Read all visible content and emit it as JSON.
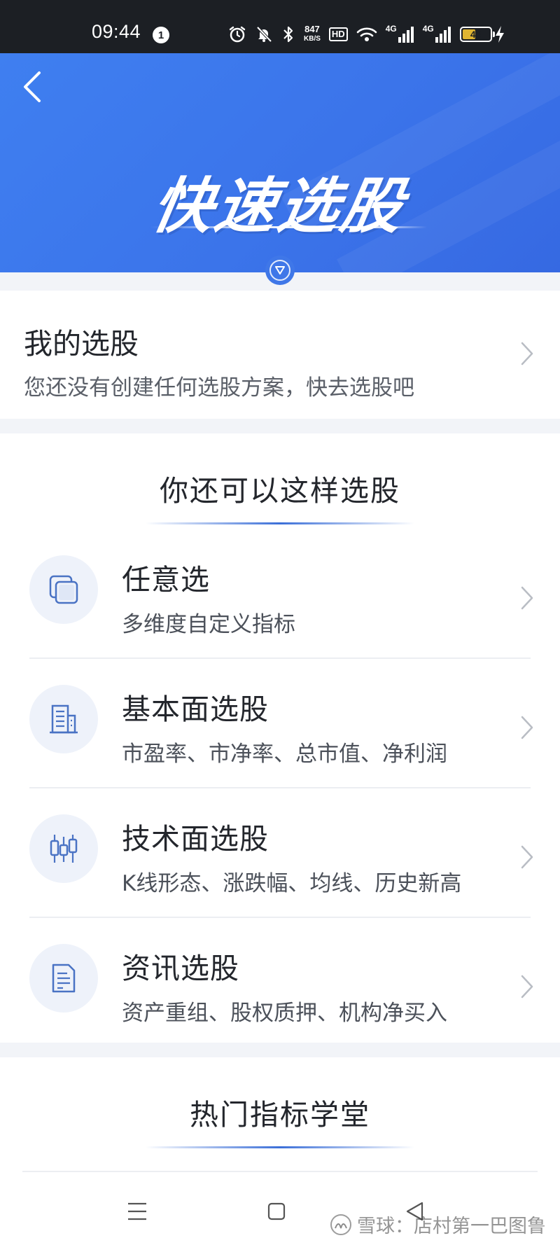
{
  "status_bar": {
    "time": "09:44",
    "notification_count": "1",
    "net_speed_value": "847",
    "net_speed_unit": "KB/S",
    "hd_badge": "HD",
    "signal_1_label": "4G",
    "signal_2_label": "4G",
    "battery_level": "48",
    "battery_fill_fraction": 0.48,
    "battery_color": "#e0b531"
  },
  "banner": {
    "title": "快速选股",
    "back_icon": "chevron-left-icon",
    "expand_icon": "triangle-down-icon",
    "accent_color": "#3b74ea"
  },
  "my_stocks": {
    "title": "我的选股",
    "subtitle": "您还没有创建任何选股方案，快去选股吧"
  },
  "alternatives": {
    "heading": "你还可以这样选股",
    "items": [
      {
        "title": "任意选",
        "description": "多维度自定义指标",
        "icon": "layers-icon"
      },
      {
        "title": "基本面选股",
        "description": "市盈率、市净率、总市值、净利润",
        "icon": "building-icon"
      },
      {
        "title": "技术面选股",
        "description": "K线形态、涨跌幅、均线、历史新高",
        "icon": "candlestick-icon"
      },
      {
        "title": "资讯选股",
        "description": "资产重组、股权质押、机构净买入",
        "icon": "document-icon"
      }
    ]
  },
  "hot_indicators": {
    "heading": "热门指标学堂"
  },
  "nav_bar": {
    "menu_icon": "menu-icon",
    "home_icon": "square-icon",
    "back_icon": "triangle-back-icon"
  },
  "watermark": {
    "text": "雪球：店村第一巴图鲁"
  }
}
